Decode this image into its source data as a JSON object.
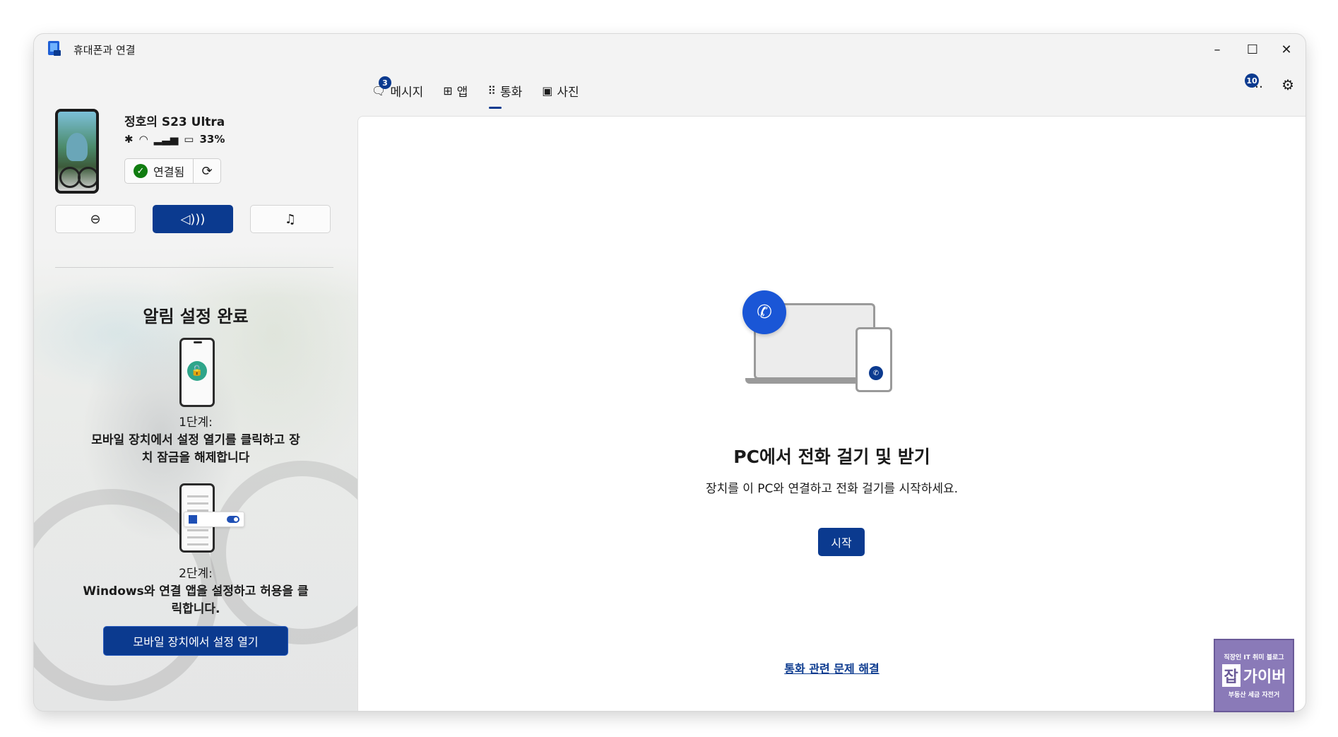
{
  "window": {
    "title": "휴대폰과 연결",
    "controls": {
      "minimize": "–",
      "maximize": "☐",
      "close": "✕"
    }
  },
  "device": {
    "name": "정호의 S23 Ultra",
    "battery": "33%",
    "status_icons": [
      "bluetooth-icon",
      "wifi-icon",
      "signal-icon",
      "battery-icon"
    ],
    "connection_label": "연결됨"
  },
  "modes": {
    "items": [
      {
        "name": "do-not-disturb",
        "glyph": "⊖",
        "active": false
      },
      {
        "name": "sound",
        "glyph": "🔊",
        "active": true
      },
      {
        "name": "music",
        "glyph": "♫",
        "active": false
      }
    ]
  },
  "setup": {
    "title": "알림 설정 완료",
    "step1_label": "1단계:",
    "step1_line1": "모바일 장치에서 설정 열기를 클릭하고 장",
    "step1_line2": "치 잠금을 해제합니다",
    "step2_label": "2단계:",
    "step2_line1": "Windows와 연결 앱을 설정하고 허용을 클",
    "step2_line2": "릭합니다.",
    "open_settings_button": "모바일 장치에서 설정 열기"
  },
  "tabs": [
    {
      "label": "메시지",
      "icon": "message-icon",
      "badge": "3",
      "active": false
    },
    {
      "label": "앱",
      "icon": "apps-icon",
      "active": false
    },
    {
      "label": "통화",
      "icon": "dialpad-icon",
      "active": true
    },
    {
      "label": "사진",
      "icon": "photo-icon",
      "active": false
    }
  ],
  "toolbar": {
    "more_glyph": "…",
    "notification_badge": "10"
  },
  "calls": {
    "title": "PC에서 전화 걸기 및 받기",
    "subtitle": "장치를 이 PC와 연결하고 전화 걸기를 시작하세요.",
    "start_button": "시작",
    "troubleshoot_link": "통화 관련 문제 해결"
  },
  "watermark": {
    "top": "직장인 IT 취미 블로그",
    "logo_part1": "잡",
    "logo_part2": "가이버",
    "bottom": "부동산 세금 자전거"
  },
  "colors": {
    "accent": "#0b3a8f",
    "success": "#107c10",
    "call_blue": "#1a56d6"
  }
}
